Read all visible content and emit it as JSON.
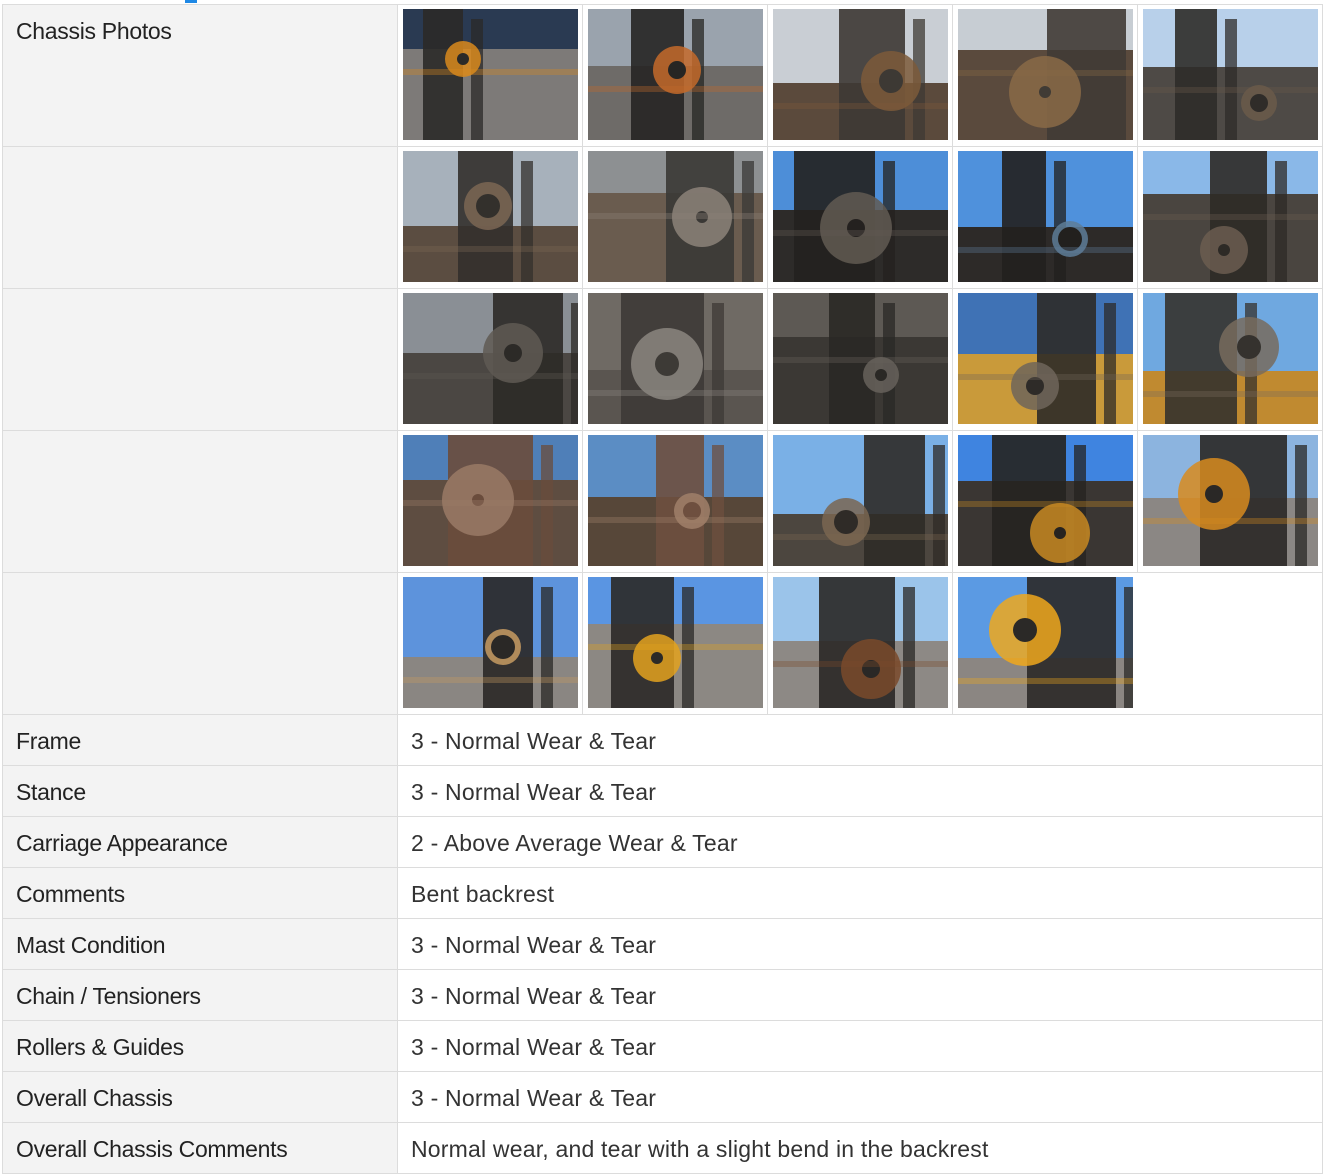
{
  "section": {
    "photos_label": "Chassis Photos",
    "photo_rows": [
      [
        {
          "name": "forklift-mast-side",
          "sky": "#2a3a52",
          "ground": "#7d7a78",
          "body": "#2b2a28",
          "accent": "#d98a1c"
        },
        {
          "name": "forklift-mast-front",
          "sky": "#9aa3ad",
          "ground": "#6e6b68",
          "body": "#262523",
          "accent": "#c46a2a"
        },
        {
          "name": "mast-bracket-closeup",
          "sky": "#c9ced4",
          "ground": "#5b4a3c",
          "body": "#3d3934",
          "accent": "#7d5a3a"
        },
        {
          "name": "mast-bracket-closeup-2",
          "sky": "#c7cdd3",
          "ground": "#5a4a3d",
          "body": "#403b35",
          "accent": "#8a6a46"
        },
        {
          "name": "mast-cylinder",
          "sky": "#b8d0ea",
          "ground": "#4e4a46",
          "body": "#2f2c29",
          "accent": "#6b5a4a"
        }
      ],
      [
        {
          "name": "cylinder-mount",
          "sky": "#a7b1bb",
          "ground": "#5b4d41",
          "body": "#33302c",
          "accent": "#7b6654"
        },
        {
          "name": "chain-pulley",
          "sky": "#8d9092",
          "ground": "#6a5c4f",
          "body": "#3a3835",
          "accent": "#8c8279"
        },
        {
          "name": "pulley-sky-view",
          "sky": "#4d8ed8",
          "ground": "#2d2b29",
          "body": "#24211f",
          "accent": "#615a52"
        },
        {
          "name": "pulley-sky-view-2",
          "sky": "#4f91dc",
          "ground": "#2d2a28",
          "body": "#22201e",
          "accent": "#5e7c98"
        },
        {
          "name": "chain-roller",
          "sky": "#8ab8e8",
          "ground": "#4a4540",
          "body": "#2d2a26",
          "accent": "#6b5d50"
        }
      ],
      [
        {
          "name": "mast-chain",
          "sky": "#8a8f95",
          "ground": "#4b4743",
          "body": "#2c2a27",
          "accent": "#5f5a54"
        },
        {
          "name": "roller-channel",
          "sky": "#6f6a64",
          "ground": "#5a5550",
          "body": "#3d3a36",
          "accent": "#8b8680"
        },
        {
          "name": "roller-channel-2",
          "sky": "#5d5954",
          "ground": "#3b3834",
          "body": "#2a2825",
          "accent": "#67625c"
        },
        {
          "name": "chain-sheave",
          "sky": "#3f72b5",
          "ground": "#c99a3a",
          "body": "#2e2b28",
          "accent": "#6f655a"
        },
        {
          "name": "chain-sheave-2",
          "sky": "#6fa8e0",
          "ground": "#c08a30",
          "body": "#35322e",
          "accent": "#786b5d"
        }
      ],
      [
        {
          "name": "hose-reel",
          "sky": "#4f7fb8",
          "ground": "#5e4d41",
          "body": "#6a4c3c",
          "accent": "#9a7a66"
        },
        {
          "name": "hose-reel-2",
          "sky": "#5b8dc4",
          "ground": "#574739",
          "body": "#6e4f3f",
          "accent": "#a0806a"
        },
        {
          "name": "mast-hoses",
          "sky": "#7ab0e6",
          "ground": "#4c463f",
          "body": "#2f2b27",
          "accent": "#7a6651"
        },
        {
          "name": "mast-upright",
          "sky": "#3f84e0",
          "ground": "#3a3633",
          "body": "#262320",
          "accent": "#c98a22"
        },
        {
          "name": "forklift-carriage",
          "sky": "#8cb4df",
          "ground": "#8b8784",
          "body": "#2a2826",
          "accent": "#d88b1f"
        }
      ],
      [
        {
          "name": "forklift-rear-mast",
          "sky": "#5d93dc",
          "ground": "#8a8682",
          "body": "#2a2826",
          "accent": "#c79b62"
        },
        {
          "name": "forklift-overview",
          "sky": "#5a95e2",
          "ground": "#8c8883",
          "body": "#2b2927",
          "accent": "#e3a21e"
        },
        {
          "name": "forks-front",
          "sky": "#9bc4ea",
          "ground": "#8d8985",
          "body": "#2a2826",
          "accent": "#7a4a2a"
        },
        {
          "name": "forklift-side",
          "sky": "#5b9ae3",
          "ground": "#8b8682",
          "body": "#2b2927",
          "accent": "#f0a81c"
        }
      ]
    ]
  },
  "fields": [
    {
      "label": "Frame",
      "value": "3 - Normal Wear & Tear"
    },
    {
      "label": "Stance",
      "value": "3 - Normal Wear & Tear"
    },
    {
      "label": "Carriage Appearance",
      "value": "2 - Above Average Wear & Tear"
    },
    {
      "label": "Comments",
      "value": "Bent backrest"
    },
    {
      "label": "Mast Condition",
      "value": "3 - Normal Wear & Tear"
    },
    {
      "label": "Chain / Tensioners",
      "value": "3 - Normal Wear & Tear"
    },
    {
      "label": "Rollers & Guides",
      "value": "3 - Normal Wear & Tear"
    },
    {
      "label": "Overall Chassis",
      "value": "3 - Normal Wear & Tear"
    },
    {
      "label": "Overall Chassis Comments",
      "value": "Normal wear, and tear with a slight bend in the backrest"
    }
  ]
}
